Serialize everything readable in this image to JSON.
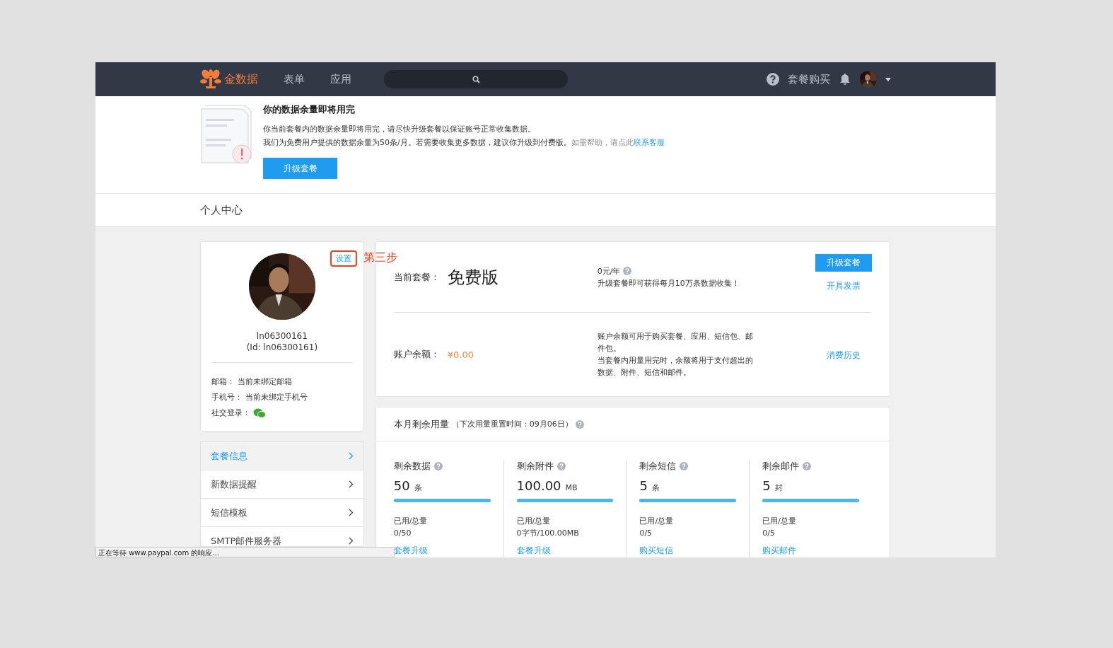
{
  "nav": {
    "brand": "金数据",
    "links": [
      "表单",
      "应用"
    ],
    "buy": "套餐购买"
  },
  "banner": {
    "title": "你的数据余量即将用完",
    "line1": "你当前套餐内的数据余量即将用完，请尽快升级套餐以保证账号正常收集数据。",
    "line2": "我们为免费用户提供的数据余量为50条/月。若需要收集更多数据，建议你升级到付费版。",
    "help": "如需帮助，请点此",
    "help_link": "联系客服",
    "button": "升级套餐"
  },
  "page_title": "个人中心",
  "profile": {
    "settings": "设置",
    "annotation": "第三步",
    "username": "ln06300161",
    "user_id": "(Id: ln06300161)",
    "fields": [
      {
        "label": "邮箱：",
        "value": "当前未绑定邮箱"
      },
      {
        "label": "手机号：",
        "value": "当前未绑定手机号"
      }
    ],
    "social_label": "社交登录："
  },
  "menu": [
    {
      "label": "套餐信息",
      "selected": true
    },
    {
      "label": "新数据提醒",
      "selected": false
    },
    {
      "label": "短信模板",
      "selected": false
    },
    {
      "label": "SMTP邮件服务器",
      "selected": false
    }
  ],
  "plan": {
    "label": "当前套餐：",
    "name": "免费版",
    "price": "0元/年",
    "desc": "升级套餐即可获得每月10万条数据收集！",
    "upgrade": "升级套餐",
    "invoice": "开具发票"
  },
  "balance": {
    "label": "账户余额：",
    "amount": "¥0.00",
    "desc1": "账户余额可用于购买套餐、应用、短信包、邮件包。",
    "desc2": "当套餐内用量用完时，余额将用于支付超出的数据、附件、短信和邮件。",
    "history": "消费历史"
  },
  "usage": {
    "title": "本月剩余用量",
    "reset": "（下次用量重置时间：09月06日）",
    "items": [
      {
        "title": "剩余数据",
        "value": "50",
        "unit": "条",
        "level": 1,
        "used_label": "已用/总量",
        "used": "0/50",
        "link": "套餐升级"
      },
      {
        "title": "剩余附件",
        "value": "100.00",
        "unit": "MB",
        "level": 1,
        "used_label": "已用/总量",
        "used": "0字节/100.00MB",
        "link": "套餐升级"
      },
      {
        "title": "剩余短信",
        "value": "5",
        "unit": "条",
        "level": 1,
        "used_label": "已用/总量",
        "used": "0/5",
        "link": "购买短信"
      },
      {
        "title": "剩余邮件",
        "value": "5",
        "unit": "封",
        "level": 1,
        "used_label": "已用/总量",
        "used": "0/5",
        "link": "购买邮件"
      }
    ]
  },
  "status_bar": "正在等待 www.paypal.com 的响应..."
}
